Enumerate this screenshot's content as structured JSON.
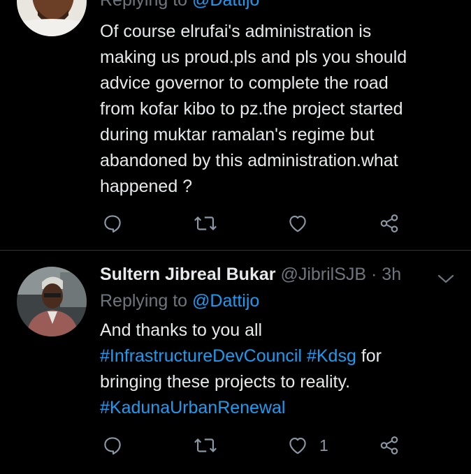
{
  "tweets": [
    {
      "replying_prefix": "Replying to ",
      "replying_mention": "@Dattijo",
      "body_lines": [
        "Of course elrufai's administration  is",
        "making us proud.pls and pls you should",
        "advice governor to complete the road",
        "from kofar kibo to pz.the project started",
        "during muktar ramalan's regime but",
        "abandoned by this administration.what",
        "happened ?"
      ],
      "actions": {
        "reply_icon": "reply-icon",
        "retweet_icon": "retweet-icon",
        "like_icon": "heart-icon",
        "share_icon": "share-icon"
      }
    },
    {
      "author_name": "Sultern Jibreal Bukar",
      "author_handle": "@JibrilSJB",
      "separator": "·",
      "timestamp": "3h",
      "replying_prefix": "Replying to ",
      "replying_mention": "@Dattijo",
      "body_line1": "And thanks to you all",
      "body_line2_tag1": "#InfrastructureDevCouncil",
      "body_line2_tag2": "#Kdsg",
      "body_line2_text": "for",
      "body_line3": "bringing these projects to reality.",
      "body_line4_tag": "#KadunaUrbanRenewal",
      "like_count": "1",
      "actions": {
        "reply_icon": "reply-icon",
        "retweet_icon": "retweet-icon",
        "like_icon": "heart-icon",
        "share_icon": "share-icon"
      }
    }
  ],
  "colors": {
    "background": "#000000",
    "text_primary": "#e7e9ea",
    "text_secondary": "#6e767d",
    "accent": "#1d9bf0",
    "divider": "#2f3336"
  }
}
